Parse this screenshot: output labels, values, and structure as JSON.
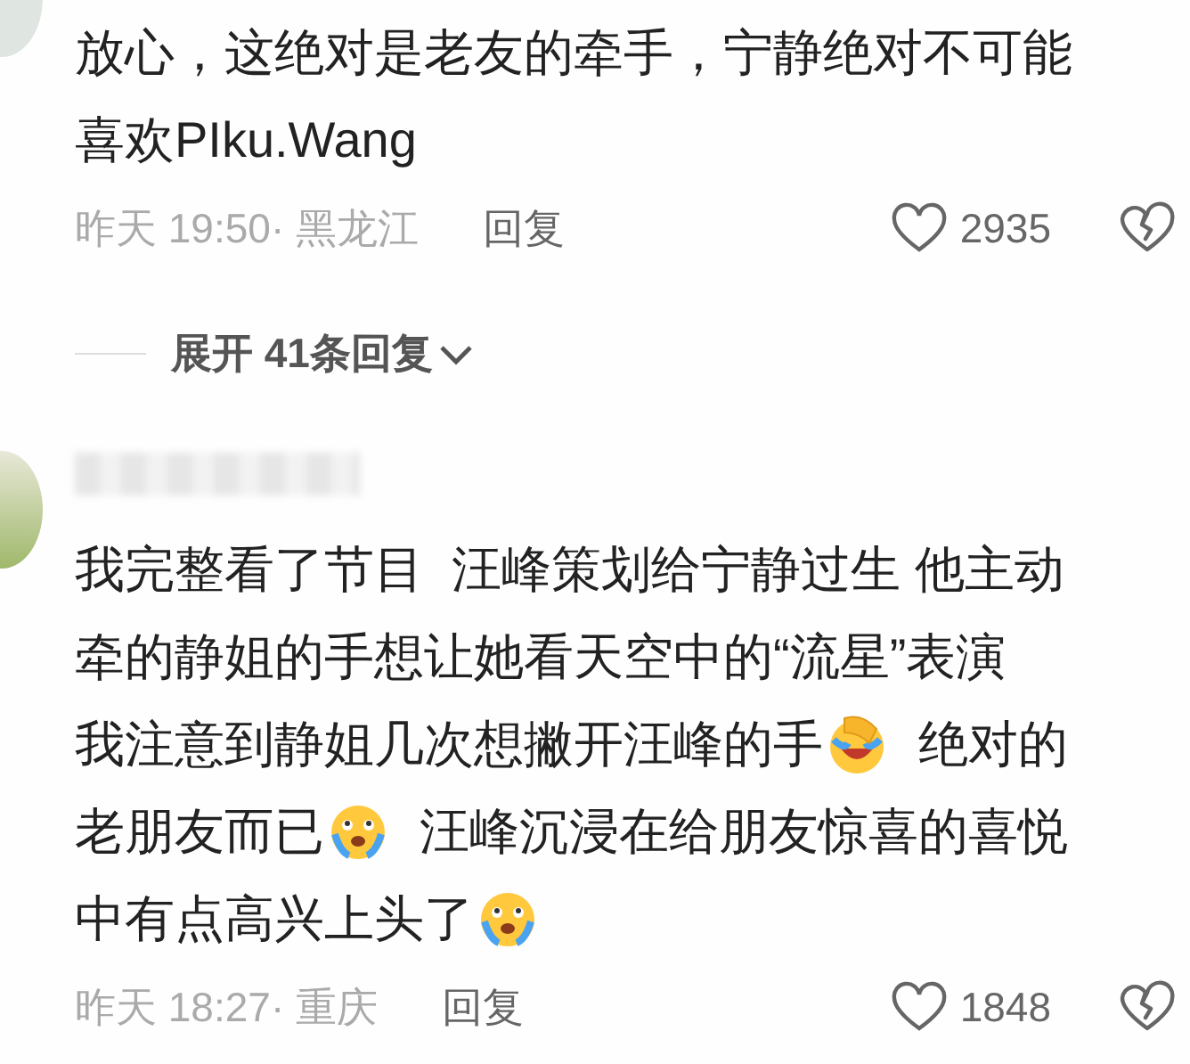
{
  "comments": [
    {
      "lines": [
        [
          {
            "kind": "text",
            "text": "放心，这绝对是老友的牵手，宁静绝对不可能"
          }
        ],
        [
          {
            "kind": "text",
            "text": "喜欢PIku.Wang"
          }
        ]
      ],
      "time": "昨天 19:50",
      "location": "· 黑龙江",
      "reply": "回复",
      "likes": "2935",
      "replies_toggle": {
        "label": "展开 41条回复",
        "expanded": false
      }
    },
    {
      "username_blurred": true,
      "lines": [
        [
          {
            "kind": "text",
            "text": "我完整看了节目  汪峰策划给宁静过生 他主动"
          }
        ],
        [
          {
            "kind": "text",
            "text": "牵的静姐的手想让她看天空中的“流星”表演"
          }
        ],
        [
          {
            "kind": "text",
            "text": "我注意到静姐几次想撇开汪峰的手"
          },
          {
            "kind": "emoji_laugh"
          },
          {
            "kind": "text",
            "text": "  绝对的"
          }
        ],
        [
          {
            "kind": "text",
            "text": "老朋友而已"
          },
          {
            "kind": "emoji_cry"
          },
          {
            "kind": "text",
            "text": "  汪峰沉浸在给朋友惊喜的喜悦"
          }
        ],
        [
          {
            "kind": "text",
            "text": "中有点高兴上头了"
          },
          {
            "kind": "emoji_cry"
          }
        ]
      ],
      "time": "昨天 18:27",
      "location": "· 重庆",
      "reply": "回复",
      "likes": "1848"
    }
  ]
}
